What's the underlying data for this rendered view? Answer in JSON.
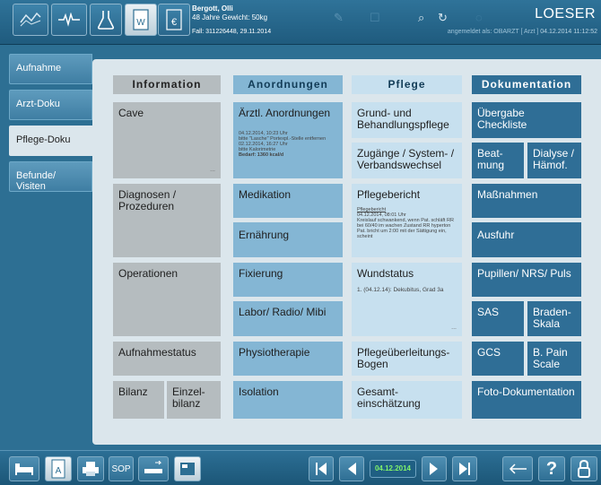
{
  "topbar": {
    "patient_name": "Bergott, Olli",
    "patient_info": "48 Jahre  Gewicht: 50kg",
    "case_info": "Fall: 311226448, 29.11.2014",
    "login_text": "angemeldet als: OBARZT [ Arzt ]",
    "login_date": "04.12.2014  11:12:52",
    "logo": "LOESER",
    "icons": [
      "chart-icon",
      "ecg-icon",
      "flask-icon",
      "w-document-icon",
      "euro-document-icon"
    ],
    "faint_icons": [
      "pen-icon",
      "binoculars-icon",
      "refresh-icon"
    ]
  },
  "sidebar": {
    "items": [
      {
        "label": "Aufnahme"
      },
      {
        "label": "Arzt-Doku"
      },
      {
        "label": "Pflege-Doku"
      },
      {
        "label": "Befunde/ Visiten"
      }
    ]
  },
  "columns": {
    "info": "Information",
    "ord": "Anordnungen",
    "pflege": "Pflege",
    "doku": "Dokumentation"
  },
  "info": {
    "cave": "Cave",
    "diagnosen": "Diagnosen / Prozeduren",
    "operationen": "Operationen",
    "aufnahmestatus": "Aufnahmestatus",
    "bilanz": "Bilanz",
    "einzelbilanz": "Einzel-bilanz"
  },
  "ord": {
    "aerztl": "Ärztl. Anordnungen",
    "aerztl_note1": "04.12.2014, 10:23 Uhr",
    "aerztl_note2": "bitte \"Lasche\" Portexpl.-Stelle entfernen",
    "aerztl_note3": "02.12.2014, 16:27 Uhr",
    "aerztl_note4": "bitte Kalorimetrie",
    "aerztl_note5": "Bedarf: 1360 kcal/d",
    "medikation": "Medikation",
    "ernaehrung": "Ernährung",
    "fixierung": "Fixierung",
    "labor": "Labor/ Radio/ Mibi",
    "physio": "Physiotherapie",
    "isolation": "Isolation"
  },
  "pflege": {
    "grund": "Grund- und Behandlungspflege",
    "zugaenge": "Zugänge / System- / Verbandswechsel",
    "bericht": "Pflegebericht",
    "bericht_note1": "Pflegebericht",
    "bericht_note2": "04.12.2014, 08:01 Uhr",
    "bericht_note3": "Kreislauf schwankend, wenn Pat. schläft RR bei 60/40 im wachen Zustand RR hyperton Pat. bricht um 2:00 mit der Sättigung ein, scheint",
    "wundstatus": "Wundstatus",
    "wund_note": "1. (04.12.14): Dekubitus, Grad 3a",
    "ueberleitung": "Pflegeüberleitungs-Bogen",
    "gesamt": "Gesamt-einschätzung"
  },
  "doku": {
    "uebergabe": "Übergabe Checkliste",
    "beatmung": "Beat-mung",
    "dialyse": "Dialyse / Hämof.",
    "massnahmen": "Maßnahmen",
    "ausfuhr": "Ausfuhr",
    "pupillen": "Pupillen/ NRS/ Puls",
    "sas": "SAS",
    "braden": "Braden-Skala",
    "gcs": "GCS",
    "bpain": "B. Pain Scale",
    "foto": "Foto-Dokumentation"
  },
  "bottombar": {
    "sop": "SOP",
    "date": "04.12.2014",
    "help": "?",
    "icons": [
      "bed-icon",
      "document-a-icon",
      "printer-icon",
      "sop-button",
      "bed-transfer-icon",
      "monitor-icon",
      "first-page-icon",
      "prev-icon",
      "next-icon",
      "last-page-icon",
      "back-arrow-icon",
      "help-icon",
      "lock-icon"
    ]
  }
}
